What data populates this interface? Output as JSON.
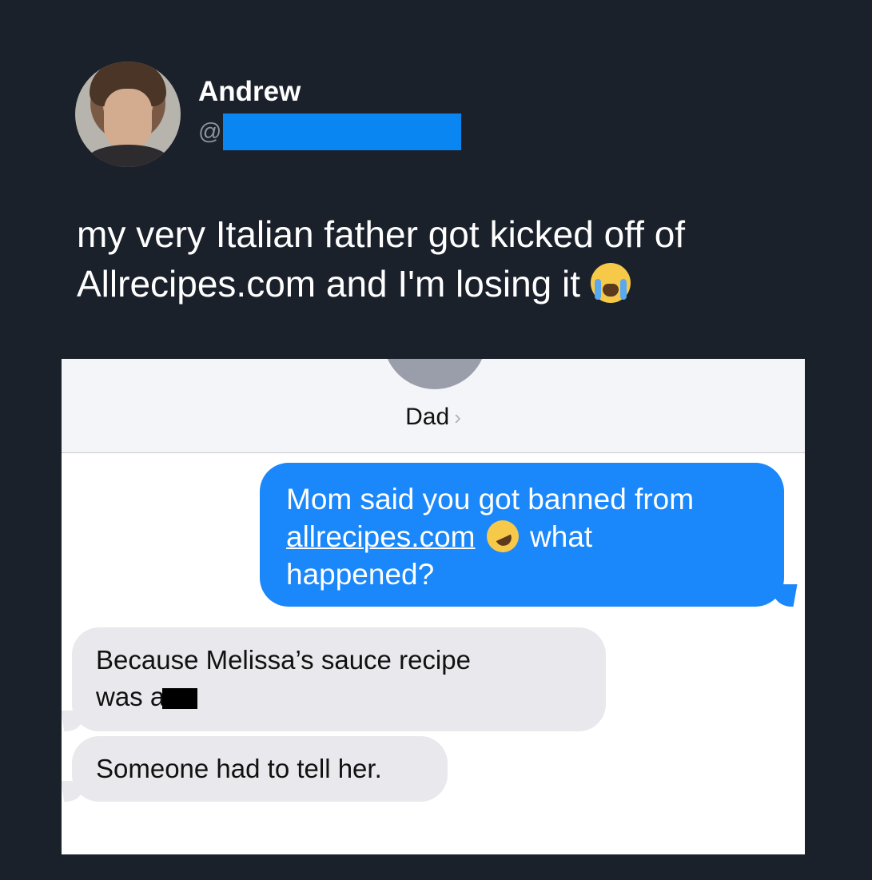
{
  "tweet": {
    "author_name": "Andrew",
    "handle_prefix": "@",
    "text_line1": "my very Italian father got kicked off of",
    "text_line2": "Allrecipes.com and I'm losing it",
    "emoji": "loudly-crying-face"
  },
  "messages_screenshot": {
    "contact_name": "Dad",
    "chevron": "›",
    "outgoing": {
      "text_start": "Mom said you got banned from",
      "link": "allrecipes.com",
      "emoji": "rolling-on-floor-laughing",
      "text_end1": "what",
      "text_end2": "happened?"
    },
    "incoming": [
      {
        "line1": "Because Melissa’s sauce recipe",
        "line2_prefix": "was a"
      },
      {
        "line1": "Someone had to tell her."
      }
    ]
  },
  "colors": {
    "background": "#1b212b",
    "handle_redaction": "#0a86f2",
    "imessage_blue": "#1a87fa",
    "incoming_bubble": "#e8e8ed"
  }
}
